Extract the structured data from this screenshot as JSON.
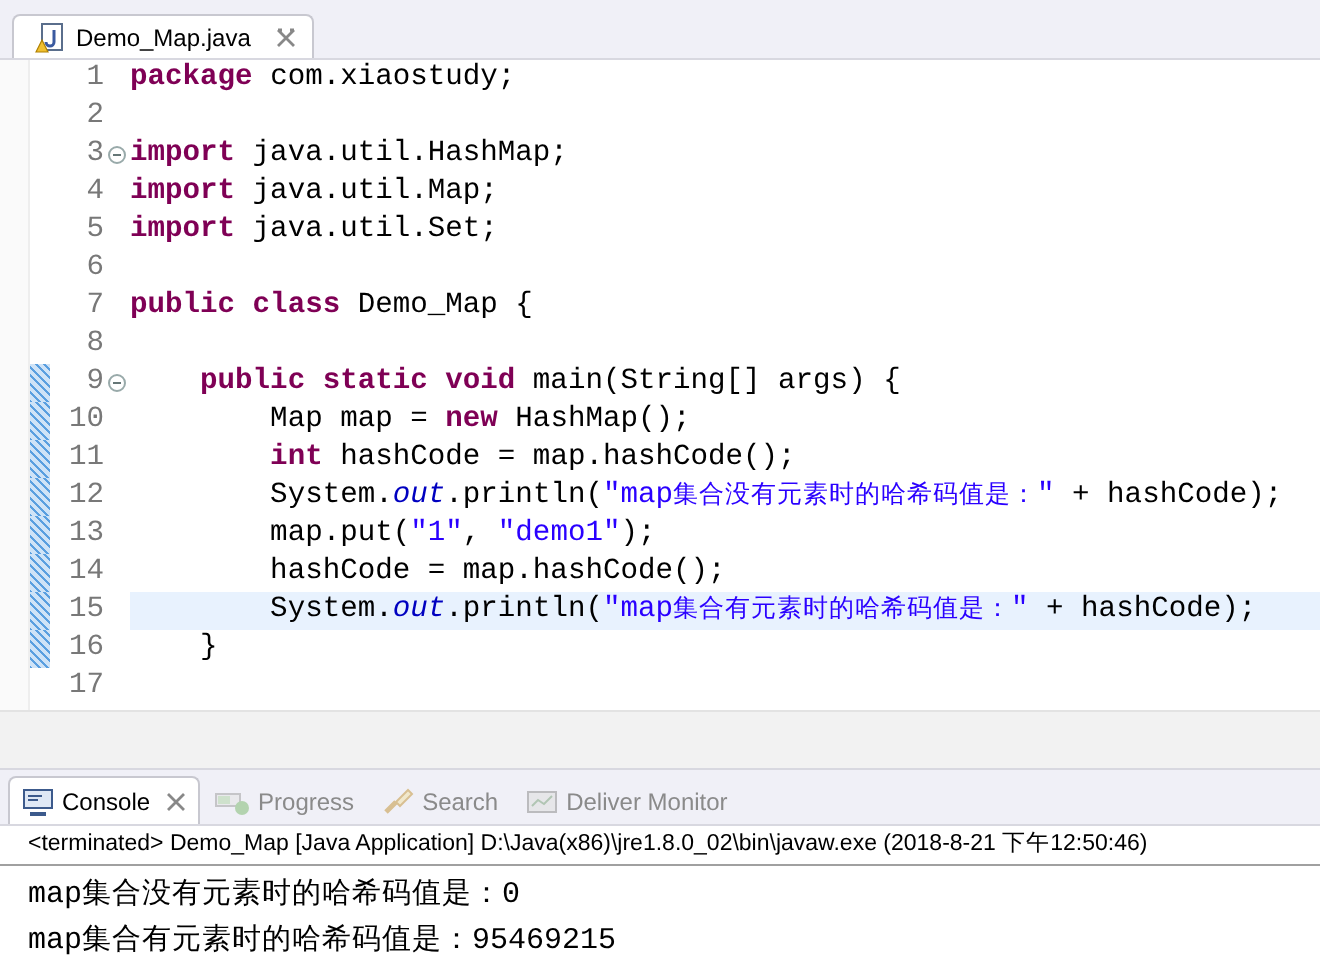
{
  "editor_tab": {
    "title": "Demo_Map.java",
    "selected": true
  },
  "lines": [
    {
      "number": "1",
      "foldable": false,
      "changed": false,
      "current": false,
      "tokens": [
        {
          "kind": "keyword",
          "text": "package"
        },
        {
          "kind": "plain",
          "text": " com.xiaostudy;"
        }
      ]
    },
    {
      "number": "2",
      "foldable": false,
      "changed": false,
      "current": false
    },
    {
      "number": "3",
      "foldable": true,
      "changed": false,
      "current": false,
      "tokens": [
        {
          "kind": "keyword",
          "text": "import"
        },
        {
          "kind": "plain",
          "text": " java.util.HashMap;"
        }
      ]
    },
    {
      "number": "4",
      "foldable": false,
      "changed": false,
      "current": false,
      "tokens": [
        {
          "kind": "keyword",
          "text": "import"
        },
        {
          "kind": "plain",
          "text": " java.util.Map;"
        }
      ]
    },
    {
      "number": "5",
      "foldable": false,
      "changed": false,
      "current": false,
      "tokens": [
        {
          "kind": "keyword",
          "text": "import"
        },
        {
          "kind": "plain",
          "text": " java.util.Set;"
        }
      ]
    },
    {
      "number": "6",
      "foldable": false,
      "changed": false,
      "current": false
    },
    {
      "number": "7",
      "foldable": false,
      "changed": false,
      "current": false,
      "tokens": [
        {
          "kind": "keyword",
          "text": "public class"
        },
        {
          "kind": "plain",
          "text": " Demo_Map {"
        }
      ]
    },
    {
      "number": "8",
      "foldable": false,
      "changed": false,
      "current": false
    },
    {
      "number": "9",
      "foldable": true,
      "changed": true,
      "current": false,
      "tokens": [
        {
          "kind": "keyword",
          "text": "    public static void"
        },
        {
          "kind": "plain",
          "text": " main(String[] args) {"
        }
      ]
    },
    {
      "number": "10",
      "foldable": false,
      "changed": true,
      "current": false,
      "tokens": [
        {
          "kind": "plain",
          "text": "        Map map = "
        },
        {
          "kind": "keyword",
          "text": "new"
        },
        {
          "kind": "plain",
          "text": " HashMap();"
        }
      ]
    },
    {
      "number": "11",
      "foldable": false,
      "changed": true,
      "current": false,
      "tokens": [
        {
          "kind": "keyword",
          "text": "        int"
        },
        {
          "kind": "plain",
          "text": " hashCode = map.hashCode();"
        }
      ]
    },
    {
      "number": "12",
      "foldable": false,
      "changed": true,
      "current": false,
      "tokens": [
        {
          "kind": "plain",
          "text": "        System."
        },
        {
          "kind": "field",
          "text": "out"
        },
        {
          "kind": "plain",
          "text": ".println("
        },
        {
          "kind": "string",
          "text": "\"map集合没有元素时的哈希码值是：\""
        },
        {
          "kind": "plain",
          "text": " + hashCode);"
        }
      ]
    },
    {
      "number": "13",
      "foldable": false,
      "changed": true,
      "current": false,
      "tokens": [
        {
          "kind": "plain",
          "text": "        map.put("
        },
        {
          "kind": "string",
          "text": "\"1\""
        },
        {
          "kind": "plain",
          "text": ", "
        },
        {
          "kind": "string",
          "text": "\"demo1\""
        },
        {
          "kind": "plain",
          "text": ");"
        }
      ]
    },
    {
      "number": "14",
      "foldable": false,
      "changed": true,
      "current": false,
      "tokens": [
        {
          "kind": "plain",
          "text": "        hashCode = map.hashCode();"
        }
      ]
    },
    {
      "number": "15",
      "foldable": false,
      "changed": true,
      "current": true,
      "tokens": [
        {
          "kind": "plain",
          "text": "        System."
        },
        {
          "kind": "field",
          "text": "out"
        },
        {
          "kind": "plain",
          "text": ".println("
        },
        {
          "kind": "string",
          "text": "\"map集合有元素时的哈希码值是：\""
        },
        {
          "kind": "plain",
          "text": " + hashCode);"
        }
      ]
    },
    {
      "number": "16",
      "foldable": false,
      "changed": true,
      "current": false,
      "tokens": [
        {
          "kind": "plain",
          "text": "    }"
        }
      ]
    },
    {
      "number": "17",
      "foldable": false,
      "changed": false,
      "current": false
    }
  ],
  "console_tabs": [
    {
      "label": "Console",
      "selected": true,
      "kind": "console"
    },
    {
      "label": "Progress",
      "selected": false,
      "kind": "progress"
    },
    {
      "label": "Search",
      "selected": false,
      "kind": "search"
    },
    {
      "label": "Deliver Monitor",
      "selected": false,
      "kind": "monitor"
    }
  ],
  "console_header": "<terminated> Demo_Map [Java Application] D:\\Java(x86)\\jre1.8.0_02\\bin\\javaw.exe (2018-8-21 下午12:50:46)",
  "console_output": [
    "map集合没有元素时的哈希码值是：0",
    "map集合有元素时的哈希码值是：95469215"
  ]
}
